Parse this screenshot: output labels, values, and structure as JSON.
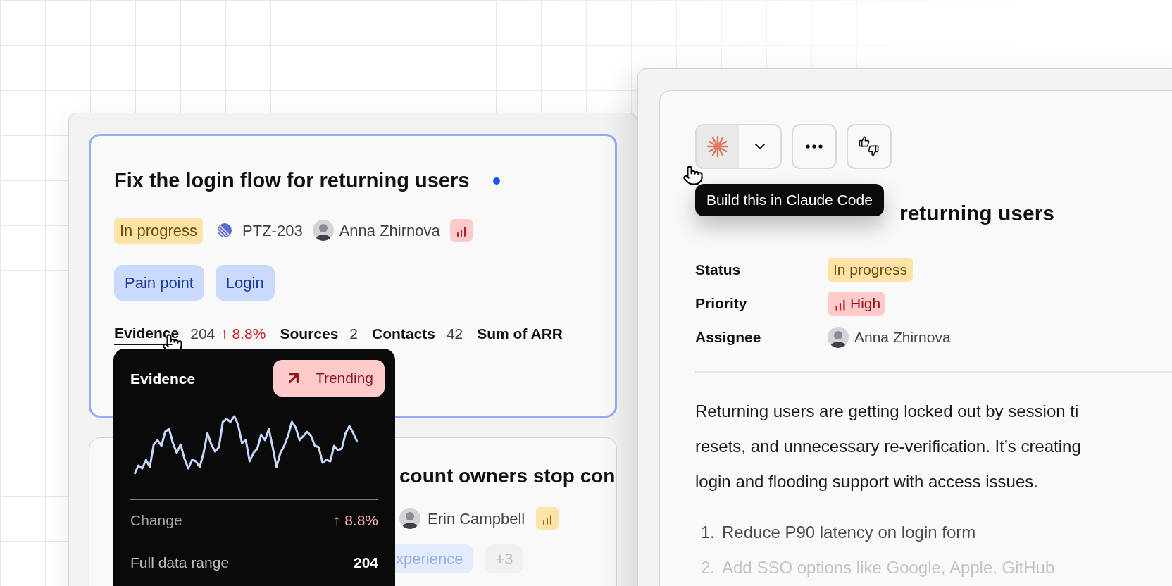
{
  "issue_list_window": {
    "card": {
      "title": "Fix the login flow for returning users",
      "selected": true,
      "unread": true,
      "status": {
        "label": "In progress",
        "color": "#fde3a7"
      },
      "issue_id": "PTZ-203",
      "assignee": "Anna Zhirnova",
      "priority_icon": {
        "color": "#fecaca"
      },
      "tags": [
        "Pain point",
        "Login"
      ],
      "metrics": [
        {
          "label": "Evidence",
          "value": "204",
          "change": "↑ 8.8%",
          "hovered": true
        },
        {
          "label": "Sources",
          "value": "2",
          "hovered": false
        },
        {
          "label": "Contacts",
          "value": "42",
          "hovered": false
        },
        {
          "label": "Sum of ARR",
          "hovered": false
        }
      ]
    },
    "evidence_popover": {
      "title": "Evidence",
      "badge": "Trending",
      "rows": [
        {
          "kind": "change",
          "label": "Change",
          "value": "↑ 8.8%"
        },
        {
          "kind": "plain",
          "label": "Full data range",
          "value": "204"
        }
      ]
    },
    "card_2": {
      "title": "count owners stop con",
      "selected": false,
      "assignee": "Erin Campbell",
      "priority_icon": {
        "color": "#fde3a7"
      },
      "tags": [
        {
          "label": "xperience",
          "kind": "tag"
        },
        {
          "label": "+3",
          "kind": "more"
        }
      ]
    }
  },
  "detail_window": {
    "toolbar": {
      "tooltip": "Build this in Claude Code"
    },
    "title": "returning users",
    "fields": [
      {
        "kind": "status",
        "label": "Status",
        "value": "In progress",
        "color": "#fde3a7"
      },
      {
        "kind": "priority",
        "label": "Priority",
        "value": "High",
        "color": "#fecaca"
      },
      {
        "kind": "person",
        "label": "Assignee",
        "value": "Anna Zhirnova"
      }
    ],
    "description": [
      "Returning users are getting locked out by session ti",
      "resets, and unnecessary re-verification. It’s creating",
      "login and flooding support with access issues."
    ],
    "steps": [
      {
        "number": "1.",
        "text": "Reduce P90 latency on login form"
      },
      {
        "number": "2.",
        "text": "Add SSO options like Google, Apple, GitHub"
      }
    ]
  }
}
